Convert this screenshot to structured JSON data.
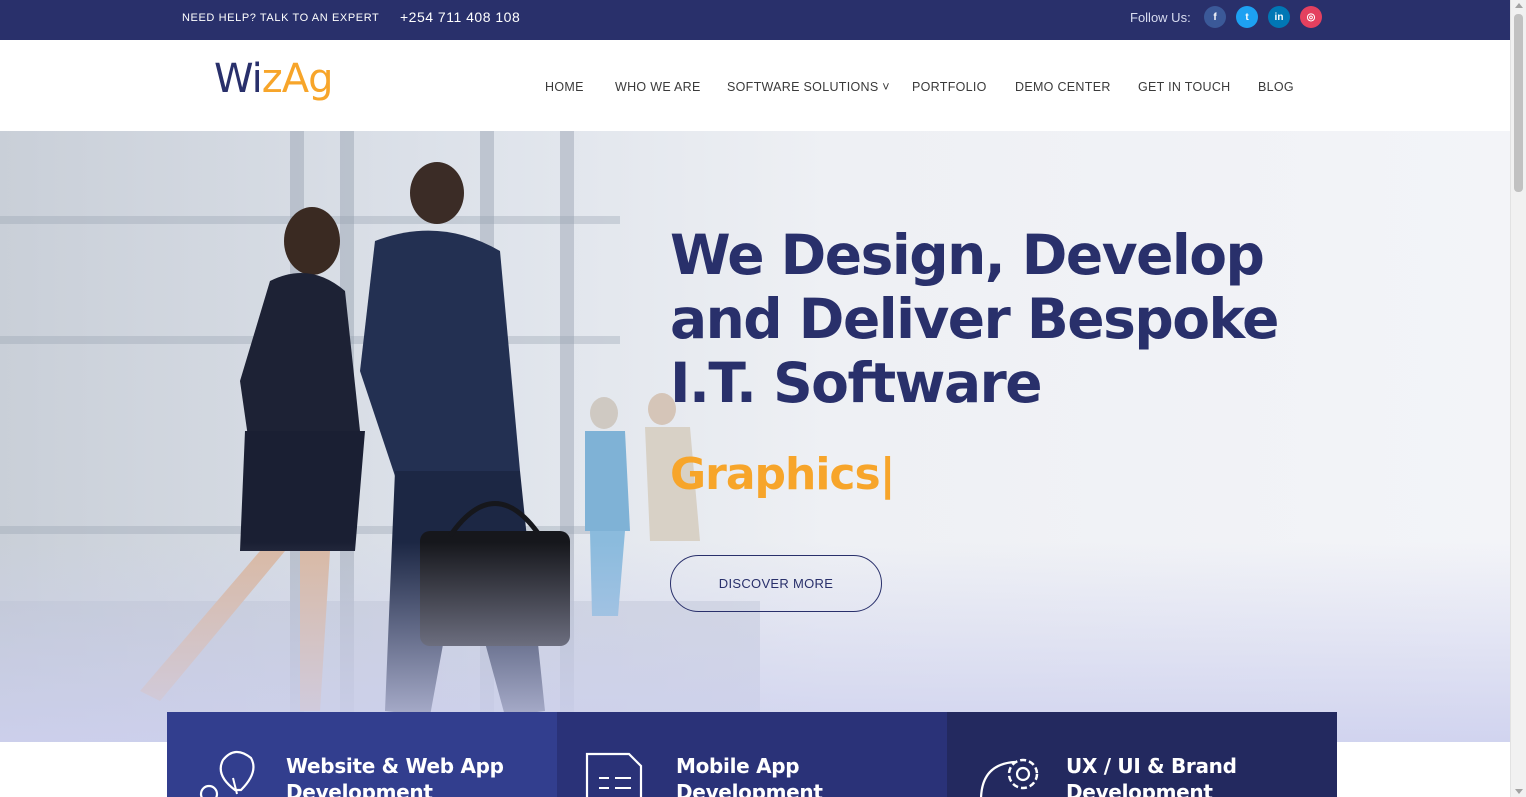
{
  "topbar": {
    "help_text": "NEED HELP? TALK TO AN EXPERT",
    "phone": "+254 711 408 108",
    "follow_label": "Follow Us:",
    "socials": [
      {
        "icon": "facebook-icon",
        "glyph": "f"
      },
      {
        "icon": "twitter-icon",
        "glyph": "t"
      },
      {
        "icon": "linkedin-icon",
        "glyph": "in"
      },
      {
        "icon": "instagram-icon",
        "glyph": "◎"
      }
    ]
  },
  "header": {
    "logo": {
      "part1": "Wi",
      "part2": "z",
      "part3": "Ag"
    },
    "nav": [
      {
        "label": "HOME"
      },
      {
        "label": "WHO WE ARE"
      },
      {
        "label": "SOFTWARE SOLUTIONS ˅"
      },
      {
        "label": "PORTFOLIO"
      },
      {
        "label": "DEMO CENTER"
      },
      {
        "label": "GET IN TOUCH"
      },
      {
        "label": "BLOG"
      }
    ]
  },
  "hero": {
    "heading_line1": "We Design, Develop",
    "heading_line2": "and Deliver Bespoke",
    "heading_line3": "I.T. Software",
    "typed_word": "Graphics|",
    "cta_label": "DISCOVER MORE"
  },
  "services": [
    {
      "title": "Website & Web App Development",
      "icon": "lightbulb-gear-icon"
    },
    {
      "title": "Mobile App Development",
      "icon": "document-list-icon"
    },
    {
      "title": "UX / UI & Brand Development",
      "icon": "gear-cycle-icon"
    }
  ],
  "colors": {
    "navy": "#29306b",
    "accent_orange": "#f7a52a",
    "card1": "#323e8e",
    "card2": "#2a3278",
    "card3": "#23295f"
  }
}
